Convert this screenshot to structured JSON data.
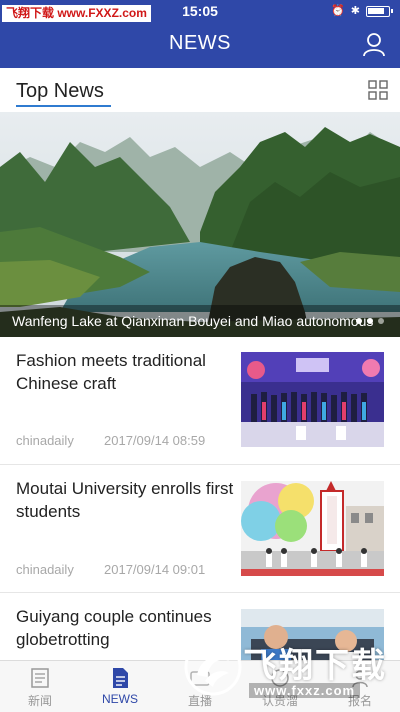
{
  "status_bar": {
    "watermark_tag": "飞翔下载 www.FXXZ.com",
    "time": "15:05"
  },
  "nav": {
    "title": "NEWS"
  },
  "section": {
    "title": "Top News"
  },
  "hero": {
    "caption": "Wanfeng Lake at Qianxinan Bouyei and Miao autonomous",
    "slide_count": 3,
    "active_slide": 1
  },
  "news": [
    {
      "title": "Fashion meets traditional Chinese craft",
      "source": "chinadaily",
      "date": "2017/09/14 08:59"
    },
    {
      "title": "Moutai University enrolls first students",
      "source": "chinadaily",
      "date": "2017/09/14 09:01"
    },
    {
      "title": "Guiyang couple continues globetrotting",
      "source": "",
      "date": ""
    }
  ],
  "tabs": [
    {
      "label": "新闻",
      "icon": "newspaper-icon",
      "active": false
    },
    {
      "label": "NEWS",
      "icon": "document-icon",
      "active": true
    },
    {
      "label": "直播",
      "icon": "live-icon",
      "active": false
    },
    {
      "label": "认贵溜",
      "icon": "discover-icon",
      "active": false
    },
    {
      "label": "报名",
      "icon": "profile-icon",
      "active": false
    }
  ],
  "watermark": {
    "brand": "飞翔下载",
    "url": "www.fxxz.com"
  },
  "colors": {
    "header_bg": "#2f48a8",
    "accent_underline": "#2f7bd0",
    "tab_active": "#2f48a8"
  }
}
